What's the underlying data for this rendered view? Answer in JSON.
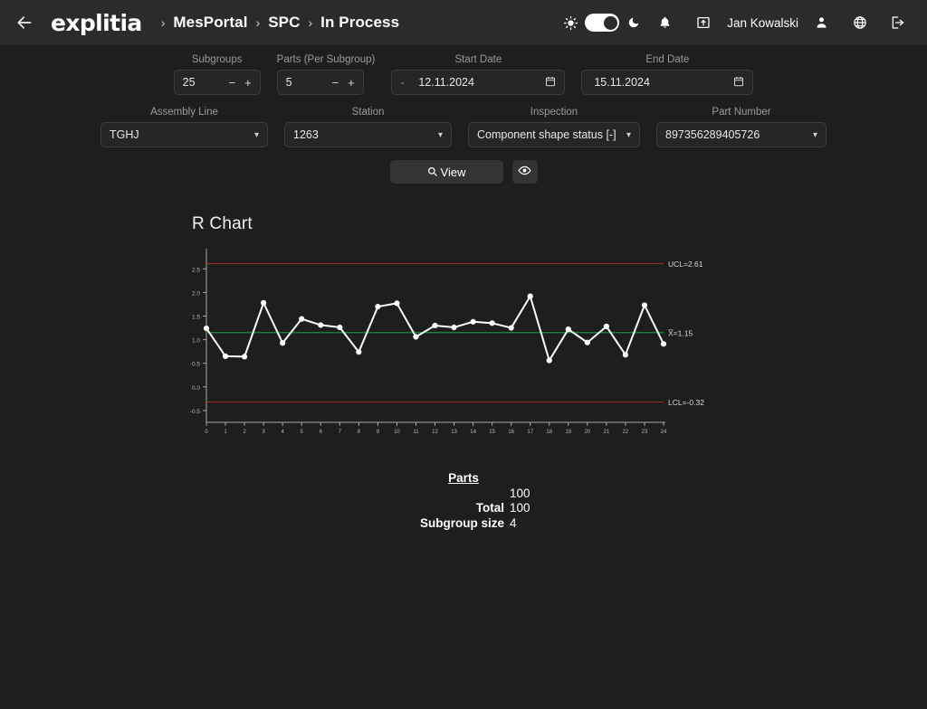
{
  "header": {
    "back_icon": "arrow-left-icon",
    "logo": "explitia",
    "breadcrumbs": [
      "MesPortal",
      "SPC",
      "In Process"
    ],
    "separator": "›",
    "sun_icon": "sun-icon",
    "moon_icon": "moon-icon",
    "theme_toggle": "dark",
    "bell_icon": "bell-icon",
    "export_icon": "export-folder-icon",
    "user_name": "Jan Kowalski",
    "person_icon": "person-icon",
    "globe_icon": "globe-icon",
    "logout_icon": "logout-icon"
  },
  "filters": {
    "subgroups": {
      "label": "Subgroups",
      "value": "25",
      "minus": "−",
      "plus": "+"
    },
    "parts_per_subgroup": {
      "label": "Parts (Per Subgroup)",
      "value": "5",
      "minus": "−",
      "plus": "+"
    },
    "start_date": {
      "label": "Start Date",
      "prefix": "-",
      "value": "12.11.2024"
    },
    "end_date": {
      "label": "End Date",
      "prefix": "",
      "value": "15.11.2024"
    },
    "assembly_line": {
      "label": "Assembly Line",
      "value": "TGHJ"
    },
    "station": {
      "label": "Station",
      "value": "1263"
    },
    "inspection": {
      "label": "Inspection",
      "value": "Component shape status [-]"
    },
    "part_number": {
      "label": "Part Number",
      "value": "897356289405726"
    }
  },
  "actions": {
    "view_label": "View",
    "search_icon": "search-icon",
    "eye_icon": "eye-icon"
  },
  "stats": {
    "header": "Parts",
    "parts_value": "100",
    "total_label": "Total",
    "total_value": "100",
    "subgroup_label": "Subgroup size",
    "subgroup_value": "4"
  },
  "colors": {
    "background": "#1e1e1e",
    "header_bg": "#2b2b2b",
    "control_limit": "#8b2f28",
    "center_line": "#1f8b3a",
    "series": "#ffffff",
    "axis": "#aaaaaa"
  },
  "chart_data": {
    "type": "line",
    "title": "R Chart",
    "xlabel": "",
    "ylabel": "",
    "x": [
      0,
      1,
      2,
      3,
      4,
      5,
      6,
      7,
      8,
      9,
      10,
      11,
      12,
      13,
      14,
      15,
      16,
      17,
      18,
      19,
      20,
      21,
      22,
      23,
      24
    ],
    "values": [
      1.24,
      0.65,
      0.64,
      1.78,
      0.93,
      1.44,
      1.31,
      1.26,
      0.74,
      1.7,
      1.77,
      1.06,
      1.3,
      1.26,
      1.38,
      1.35,
      1.25,
      1.92,
      0.56,
      1.22,
      0.94,
      1.28,
      0.68,
      1.73,
      0.91
    ],
    "series": [
      {
        "name": "R",
        "values": [
          1.24,
          0.65,
          0.64,
          1.78,
          0.93,
          1.44,
          1.31,
          1.26,
          0.74,
          1.7,
          1.77,
          1.06,
          1.3,
          1.26,
          1.38,
          1.35,
          1.25,
          1.92,
          0.56,
          1.22,
          0.94,
          1.28,
          0.68,
          1.73,
          0.91
        ]
      }
    ],
    "xticks": [
      "0",
      "1",
      "2",
      "3",
      "4",
      "5",
      "6",
      "7",
      "8",
      "9",
      "10",
      "11",
      "12",
      "13",
      "14",
      "15",
      "16",
      "17",
      "18",
      "19",
      "20",
      "21",
      "22",
      "23",
      "24"
    ],
    "yticks": [
      "-0.5",
      "0.0",
      "0.5",
      "1.0",
      "1.5",
      "2.0",
      "2.5"
    ],
    "ytick_values": [
      -0.5,
      0.0,
      0.5,
      1.0,
      1.5,
      2.0,
      2.5
    ],
    "ylim": [
      -0.75,
      2.85
    ],
    "xlim": [
      0,
      24
    ],
    "grid": false,
    "legend": "none",
    "annotations": [
      {
        "name": "UCL",
        "label": "UCL=2.61",
        "value": 2.61,
        "color": "#8b2f28"
      },
      {
        "name": "center",
        "label": "X̅=1.15",
        "value": 1.15,
        "color": "#1f8b3a"
      },
      {
        "name": "LCL",
        "label": "LCL=-0.32",
        "value": -0.32,
        "color": "#8b2f28"
      }
    ]
  }
}
